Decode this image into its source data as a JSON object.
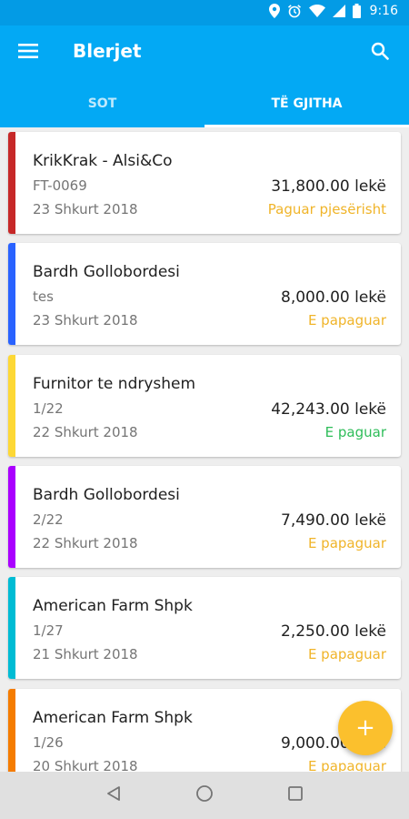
{
  "status_bar": {
    "time": "9:16",
    "icons": [
      "location-icon",
      "alarm-icon",
      "wifi-icon",
      "cell-signal-icon",
      "battery-icon"
    ]
  },
  "app_bar": {
    "title": "Blerjet",
    "menu_icon": "menu-icon",
    "search_icon": "search-icon"
  },
  "tabs": [
    {
      "label": "SOT",
      "active": false
    },
    {
      "label": "TË GJITHA",
      "active": true
    }
  ],
  "colors": {
    "primary": "#03a9f4",
    "primary_dark": "#039be5",
    "paid": "#2ebd59",
    "unpaid": "#f0b429",
    "fab": "#fbc02d"
  },
  "purchases": [
    {
      "name": "KrikKrak - Alsi&Co",
      "ref": "FT-0069",
      "date": "23 Shkurt 2018",
      "amount": "31,800.00 lekë",
      "status": "Paguar pjesërisht",
      "status_color": "#f0b429",
      "accent": "#c62828"
    },
    {
      "name": "Bardh Gollobordesi",
      "ref": "tes",
      "date": "23 Shkurt 2018",
      "amount": "8,000.00 lekë",
      "status": "E papaguar",
      "status_color": "#f0b429",
      "accent": "#2962ff"
    },
    {
      "name": "Furnitor te ndryshem",
      "ref": "1/22",
      "date": "22 Shkurt 2018",
      "amount": "42,243.00 lekë",
      "status": "E paguar",
      "status_color": "#2ebd59",
      "accent": "#fdd835"
    },
    {
      "name": "Bardh Gollobordesi",
      "ref": "2/22",
      "date": "22 Shkurt 2018",
      "amount": "7,490.00 lekë",
      "status": "E papaguar",
      "status_color": "#f0b429",
      "accent": "#aa00ff"
    },
    {
      "name": "American Farm Shpk",
      "ref": "1/27",
      "date": "21 Shkurt 2018",
      "amount": "2,250.00 lekë",
      "status": "E papaguar",
      "status_color": "#f0b429",
      "accent": "#00bcd4"
    },
    {
      "name": "American Farm Shpk",
      "ref": "1/26",
      "date": "20 Shkurt 2018",
      "amount": "9,000.00 lekë",
      "status": "E papaguar",
      "status_color": "#f0b429",
      "accent": "#f57c00"
    }
  ],
  "fab": {
    "icon": "plus-icon",
    "label": "+"
  },
  "nav": [
    "back-icon",
    "home-icon",
    "recents-icon"
  ]
}
